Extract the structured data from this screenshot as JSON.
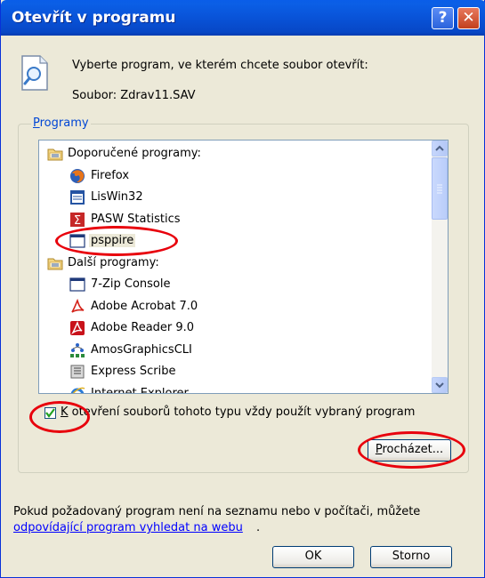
{
  "window": {
    "title": "Otevřít v programu"
  },
  "intro": {
    "text": "Vyberte program, ve kterém chcete soubor otevřít:",
    "file": "Soubor:  Zdrav11.SAV"
  },
  "programs": {
    "legend_first": "P",
    "legend_rest": "rogramy",
    "recommended_label": "Doporučené programy:",
    "recommended": [
      {
        "name": "Firefox",
        "icon": "firefox-icon"
      },
      {
        "name": "LisWin32",
        "icon": "liswin-icon"
      },
      {
        "name": "PASW Statistics",
        "icon": "pasw-icon"
      },
      {
        "name": "psppire",
        "icon": "window-app-icon"
      }
    ],
    "other_label": "Další programy:",
    "other": [
      {
        "name": "7-Zip Console",
        "icon": "window-app-icon"
      },
      {
        "name": "Adobe Acrobat 7.0",
        "icon": "acrobat-icon"
      },
      {
        "name": "Adobe Reader 9.0",
        "icon": "reader-icon"
      },
      {
        "name": "AmosGraphicsCLI",
        "icon": "amos-icon"
      },
      {
        "name": "Express Scribe",
        "icon": "scribe-icon"
      },
      {
        "name": "Internet Explorer",
        "icon": "ie-icon"
      }
    ]
  },
  "checkbox": {
    "checked": true,
    "label_first": "K",
    "label_rest": " otevření souborů tohoto typu vždy použít vybraný program"
  },
  "buttons": {
    "browse_first": "P",
    "browse_rest": "rocházet...",
    "ok": "OK",
    "cancel": "Storno"
  },
  "footer": {
    "text": "Pokud požadovaný program není na seznamu nebo v počítači, můžete",
    "link": "odpovídající program vyhledat na webu",
    "link_suffix": "."
  },
  "colors": {
    "title_bar": "#0953d8",
    "dialog_bg": "#ece9d8",
    "link": "#0000ff",
    "legend": "#0046d5",
    "annotation": "#e8000c"
  }
}
